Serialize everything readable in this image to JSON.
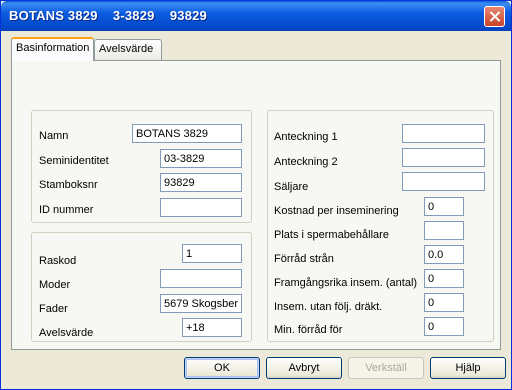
{
  "window": {
    "title": "BOTANS 3829    3-3829    93829"
  },
  "tabs": [
    {
      "label": "Basinformation",
      "active": true
    },
    {
      "label": "Avelsvärde",
      "active": false
    }
  ],
  "identity": {
    "name_label": "Namn",
    "name_value": "BOTANS 3829",
    "semin_label": "Seminidentitet",
    "semin_value": "03-3829",
    "stambok_label": "Stamboksnr",
    "stambok_value": "93829",
    "id_label": "ID nummer",
    "id_value": ""
  },
  "breeding": {
    "raskod_label": "Raskod",
    "raskod_value": "1",
    "moder_label": "Moder",
    "moder_value": "",
    "fader_label": "Fader",
    "fader_value": "5679 Skogsber",
    "avelsvarde_label": "Avelsvärde",
    "avelsvarde_value": "+18"
  },
  "notes": {
    "anteckning1_label": "Anteckning 1",
    "anteckning1_value": "",
    "anteckning2_label": "Anteckning 2",
    "anteckning2_value": "",
    "saljare_label": "Säljare",
    "saljare_value": "",
    "kostnad_label": "Kostnad per inseminering",
    "kostnad_value": "0",
    "plats_label": "Plats i spermabehållare",
    "plats_value": "",
    "forrad_label": "Förråd strån",
    "forrad_value": "0.0",
    "framgang_label": "Framgångsrika insem. (antal)",
    "framgang_value": "0",
    "insem_label": "Insem. utan följ. dräkt.",
    "insem_value": "0",
    "minforrad_label": "Min. förråd för",
    "minforrad_value": "0"
  },
  "buttons": {
    "ok": "OK",
    "cancel": "Avbryt",
    "apply": "Verkställ",
    "help": "Hjälp"
  },
  "colors": {
    "title_bar": "#0b5ce0",
    "tab_highlight": "#f7a21a",
    "face": "#ece9d8"
  }
}
